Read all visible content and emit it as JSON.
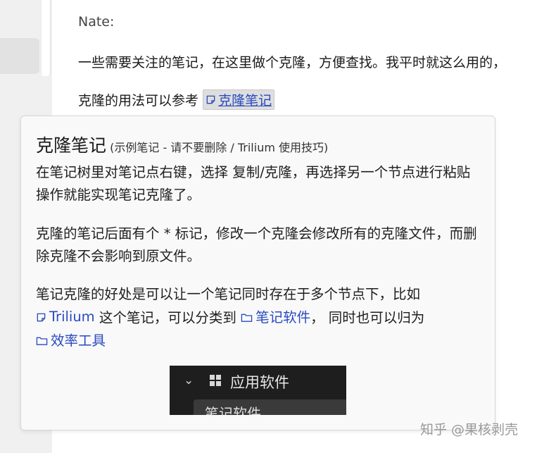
{
  "note": {
    "author": "Nate:",
    "line1": "一些需要关注的笔记，在这里做个克隆，方便查找。我平时就这么用的，",
    "line2_prefix": "克隆的用法可以参考",
    "line2_link": "克隆笔记"
  },
  "popup": {
    "title": "克隆笔记",
    "subtitle": "(示例笔记 - 请不要删除 / Trilium 使用技巧)",
    "p1": "在笔记树里对笔记点右键，选择 复制/克隆，再选择另一个节点进行粘贴操作就能实现笔记克隆了。",
    "p2": "克隆的笔记后面有个 * 标记，修改一个克隆会修改所有的克隆文件，而删除克隆不会影响到原文件。",
    "p3": {
      "text_a": "笔记克隆的好处是可以让一个笔记同时存在于多个节点下，比如",
      "link_trilium": "Trilium",
      "text_b": "这个笔记，可以分类到",
      "link_notes_software": "笔记软件",
      "text_c": "， 同时也可以归为",
      "link_efficiency": "效率工具"
    },
    "thumbnail": {
      "row1_label": "应用软件",
      "row2_label": "笔记软件"
    }
  },
  "watermark": "知乎 @果核剥壳",
  "colors": {
    "link": "#2a4ac0",
    "popup_bg": "#f9f9f9",
    "thumb_bg": "#1e1e1e"
  }
}
